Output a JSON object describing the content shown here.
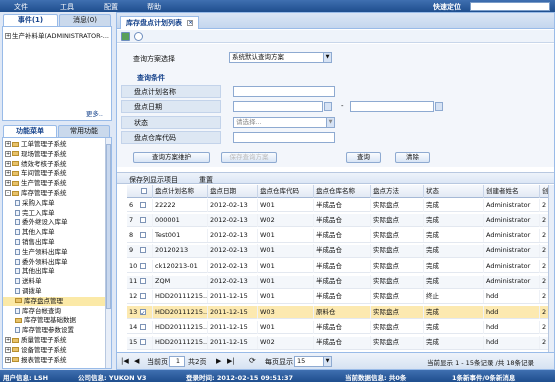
{
  "menu": {
    "items": [
      "文件",
      "工具",
      "配置",
      "帮助"
    ],
    "quick_locate_label": "快速定位"
  },
  "left": {
    "top_tabs": [
      "事件(1)",
      "消息(0)"
    ],
    "event_item": "生产补料单(ADMINISTRATOR-...",
    "more_link": "更多..",
    "bottom_tabs": [
      "功能菜单",
      "常用功能"
    ],
    "tree": [
      {
        "label": "工单管理子系统",
        "type": "folder",
        "expand": "+"
      },
      {
        "label": "现场管理子系统",
        "type": "folder",
        "expand": "+"
      },
      {
        "label": "绩效考核子系统",
        "type": "folder",
        "expand": "+"
      },
      {
        "label": "车间管理子系统",
        "type": "folder",
        "expand": "+"
      },
      {
        "label": "生产管理子系统",
        "type": "folder",
        "expand": "+"
      },
      {
        "label": "库存管理子系统",
        "type": "folder",
        "expand": "-"
      },
      {
        "label": "采购入库单",
        "type": "file",
        "indent": 1
      },
      {
        "label": "完工入库单",
        "type": "file",
        "indent": 1
      },
      {
        "label": "委外继设入库单",
        "type": "file",
        "indent": 1
      },
      {
        "label": "其他入库单",
        "type": "file",
        "indent": 1
      },
      {
        "label": "销售出库单",
        "type": "file",
        "indent": 1
      },
      {
        "label": "生产领料出库单",
        "type": "file",
        "indent": 1
      },
      {
        "label": "委外领料出库单",
        "type": "file",
        "indent": 1
      },
      {
        "label": "其他出库单",
        "type": "file",
        "indent": 1
      },
      {
        "label": "送料单",
        "type": "file",
        "indent": 1
      },
      {
        "label": "调拨单",
        "type": "file",
        "indent": 1
      },
      {
        "label": "库存盘点管理",
        "type": "folder",
        "indent": 1,
        "selected": true
      },
      {
        "label": "库存台帐查询",
        "type": "file",
        "indent": 1
      },
      {
        "label": "库存管理基础数据",
        "type": "folder",
        "indent": 1
      },
      {
        "label": "库存管理参数设置",
        "type": "file",
        "indent": 1
      },
      {
        "label": "质量管理子系统",
        "type": "folder",
        "expand": "+"
      },
      {
        "label": "设备管理子系统",
        "type": "folder",
        "expand": "+"
      },
      {
        "label": "报表管理子系统",
        "type": "folder",
        "expand": "+"
      }
    ]
  },
  "right": {
    "tab_label": "库存盘点计划列表",
    "query": {
      "scheme_label": "查询方案选择",
      "scheme_value": "系统默认查询方案",
      "conditions_label": "查询条件",
      "name_label": "盘点计划名称",
      "date_label": "盘点日期",
      "date_sep": "-",
      "status_label": "状态",
      "status_placeholder": "请选择...",
      "warehouse_label": "盘点仓库代码",
      "maintain_button": "查询方案维护",
      "save_button": "保存查询方案",
      "query_button": "查询",
      "clear_button": "清除"
    },
    "grid_toolbar": {
      "save_cols": "保存列显示项目",
      "reset": "重置"
    },
    "grid": {
      "columns": [
        "",
        "盘点计划名称",
        "盘点日期",
        "盘点仓库代码",
        "盘点仓库名称",
        "盘点方法",
        "状态",
        "创建者姓名",
        "创"
      ],
      "rows": [
        {
          "no": "6",
          "name": "22222",
          "date": "2012-02-13",
          "wh_code": "W01",
          "wh_name": "半成品仓",
          "method": "实际盘点",
          "status": "完成",
          "creator": "Administrator",
          "extra": "2"
        },
        {
          "no": "7",
          "name": "000001",
          "date": "2012-02-13",
          "wh_code": "W02",
          "wh_name": "半成品仓",
          "method": "实际盘点",
          "status": "完成",
          "creator": "Administrator",
          "extra": "2"
        },
        {
          "no": "8",
          "name": "Test001",
          "date": "2012-02-13",
          "wh_code": "W01",
          "wh_name": "半成品仓",
          "method": "实际盘点",
          "status": "完成",
          "creator": "Administrator",
          "extra": "2"
        },
        {
          "no": "9",
          "name": "20120213",
          "date": "2012-02-13",
          "wh_code": "W01",
          "wh_name": "半成品仓",
          "method": "实际盘点",
          "status": "完成",
          "creator": "Administrator",
          "extra": "2"
        },
        {
          "no": "10",
          "name": "ck120213-01",
          "date": "2012-02-13",
          "wh_code": "W01",
          "wh_name": "半成品仓",
          "method": "实际盘点",
          "status": "完成",
          "creator": "Administrator",
          "extra": "2"
        },
        {
          "no": "11",
          "name": "ZQM",
          "date": "2012-02-13",
          "wh_code": "W01",
          "wh_name": "半成品仓",
          "method": "实际盘点",
          "status": "完成",
          "creator": "Administrator",
          "extra": "2"
        },
        {
          "no": "12",
          "name": "HDD20111215...",
          "date": "2011-12-15",
          "wh_code": "W01",
          "wh_name": "半成品仓",
          "method": "实际盘点",
          "status": "终止",
          "creator": "hdd",
          "extra": "2"
        },
        {
          "no": "13",
          "name": "HDD20111215...",
          "date": "2011-12-15",
          "wh_code": "W03",
          "wh_name": "原料仓",
          "method": "实际盘点",
          "status": "完成",
          "creator": "hdd",
          "extra": "2",
          "checked": true,
          "highlight": true
        },
        {
          "no": "14",
          "name": "HDD20111215...",
          "date": "2011-12-15",
          "wh_code": "W01",
          "wh_name": "半成品仓",
          "method": "实际盘点",
          "status": "完成",
          "creator": "hdd",
          "extra": "2"
        },
        {
          "no": "15",
          "name": "HDD20111215...",
          "date": "2011-12-15",
          "wh_code": "W02",
          "wh_name": "半成品仓",
          "method": "实际盘点",
          "status": "完成",
          "creator": "hdd",
          "extra": "2"
        }
      ]
    },
    "pager": {
      "page_prefix": "当前页",
      "page_value": "1",
      "page_total": "共2页",
      "per_page_label": "每页显示",
      "per_page_value": "15",
      "summary": "当前显示 1 - 15条记录 /共 18条记录"
    }
  },
  "status": {
    "user": "用户信息: LSH",
    "company": "公司信息: YUKON V3",
    "login": "登录时间: 2012-02-15 09:51:37",
    "data": "当前数据信息: 共0条",
    "events": "1条新事件/0条新消息"
  }
}
